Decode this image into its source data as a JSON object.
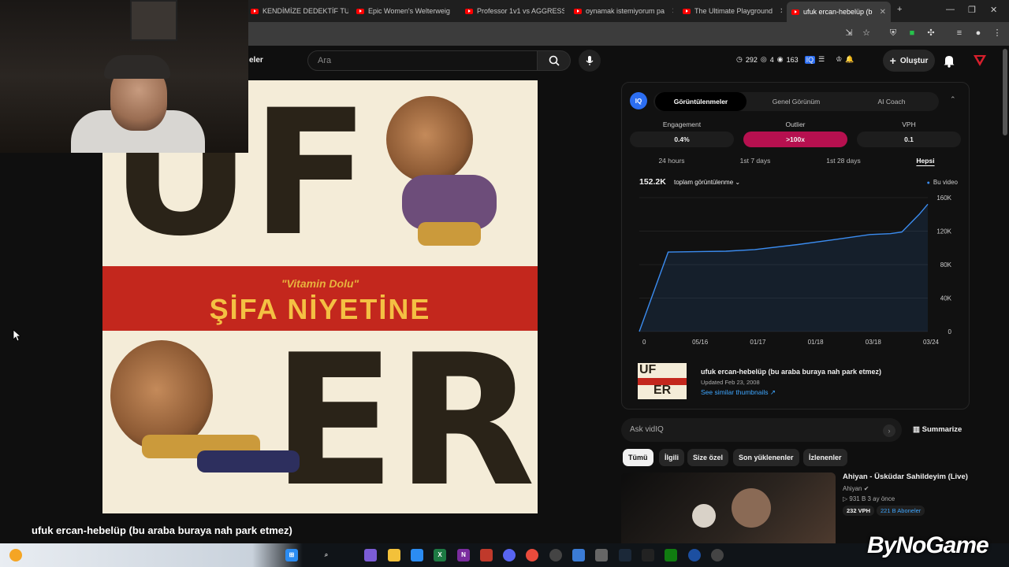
{
  "tabs": [
    {
      "label": "KENDİMİZE DEDEKTİF TUT",
      "active": false
    },
    {
      "label": "Epic Women's Welterweig",
      "active": false
    },
    {
      "label": "Professor 1v1 vs AGGRESS",
      "active": false
    },
    {
      "label": "oynamak istemiyorum pa",
      "active": false
    },
    {
      "label": "The Ultimate Playground",
      "active": false
    },
    {
      "label": "ufuk ercan-hebelüp (b",
      "active": true
    }
  ],
  "masthead": {
    "nav_fragment": "eler",
    "search_placeholder": "Ara",
    "stats": {
      "clock": "292",
      "eye": "4",
      "views": "163"
    },
    "create_label": "Oluştur"
  },
  "video": {
    "title": "ufuk ercan-hebelüp (bu araba buraya nah park etmez)",
    "frame_top_letters": "UF",
    "frame_bottom_letters": "ER",
    "banner_small": "\"Vitamin Dolu\"",
    "banner_main": "ŞİFA NİYETİNE"
  },
  "vidiq": {
    "logo": "IQ",
    "tabs": [
      "Görüntülenmeler",
      "Genel Görünüm",
      "AI Coach"
    ],
    "metrics": [
      {
        "label": "Engagement",
        "value": "0.4%"
      },
      {
        "label": "Outlier",
        "value": ">100x"
      },
      {
        "label": "VPH",
        "value": "0.1"
      }
    ],
    "ranges": [
      "24 hours",
      "1st 7 days",
      "1st 28 days",
      "Hepsi"
    ],
    "total_views": "152.2K",
    "metric_dropdown": "toplam görüntülenme",
    "legend": "Bu video",
    "video_card": {
      "title": "ufuk ercan-hebelüp (bu araba buraya nah park etmez)",
      "updated": "Updated Feb 23, 2008",
      "link": "See similar thumbnails ↗"
    }
  },
  "chart_data": {
    "type": "area",
    "x": [
      "0",
      "05/16",
      "01/17",
      "01/18",
      "03/18",
      "03/24"
    ],
    "x_ticks": [
      "0",
      "05/16",
      "01/17",
      "01/18",
      "03/18",
      "03/24"
    ],
    "y_ticks": [
      "160K",
      "120K",
      "80K",
      "40K",
      "0"
    ],
    "ylim": [
      0,
      160000
    ],
    "series": [
      {
        "name": "Bu video",
        "values": [
          0,
          95000,
          96000,
          98000,
          104000,
          110000,
          116000,
          117000,
          119000,
          140000,
          152200
        ]
      }
    ],
    "grid": true,
    "color": "#3b8cf0"
  },
  "ask": {
    "placeholder": "Ask vidIQ",
    "summarize": "Summarize"
  },
  "chips": [
    "Tümü",
    "İlgili",
    "Size özel",
    "Son yüklenenler",
    "İzlenenler"
  ],
  "recommendation": {
    "title": "Ahiyan - Üsküdar Sahildeyim (Live)",
    "channel": "Ahiyan",
    "meta": "▷ 931 B  3 ay önce",
    "vph": "232 VPH",
    "subs": "221 B Aboneler"
  },
  "watermark": "ByNoGame"
}
